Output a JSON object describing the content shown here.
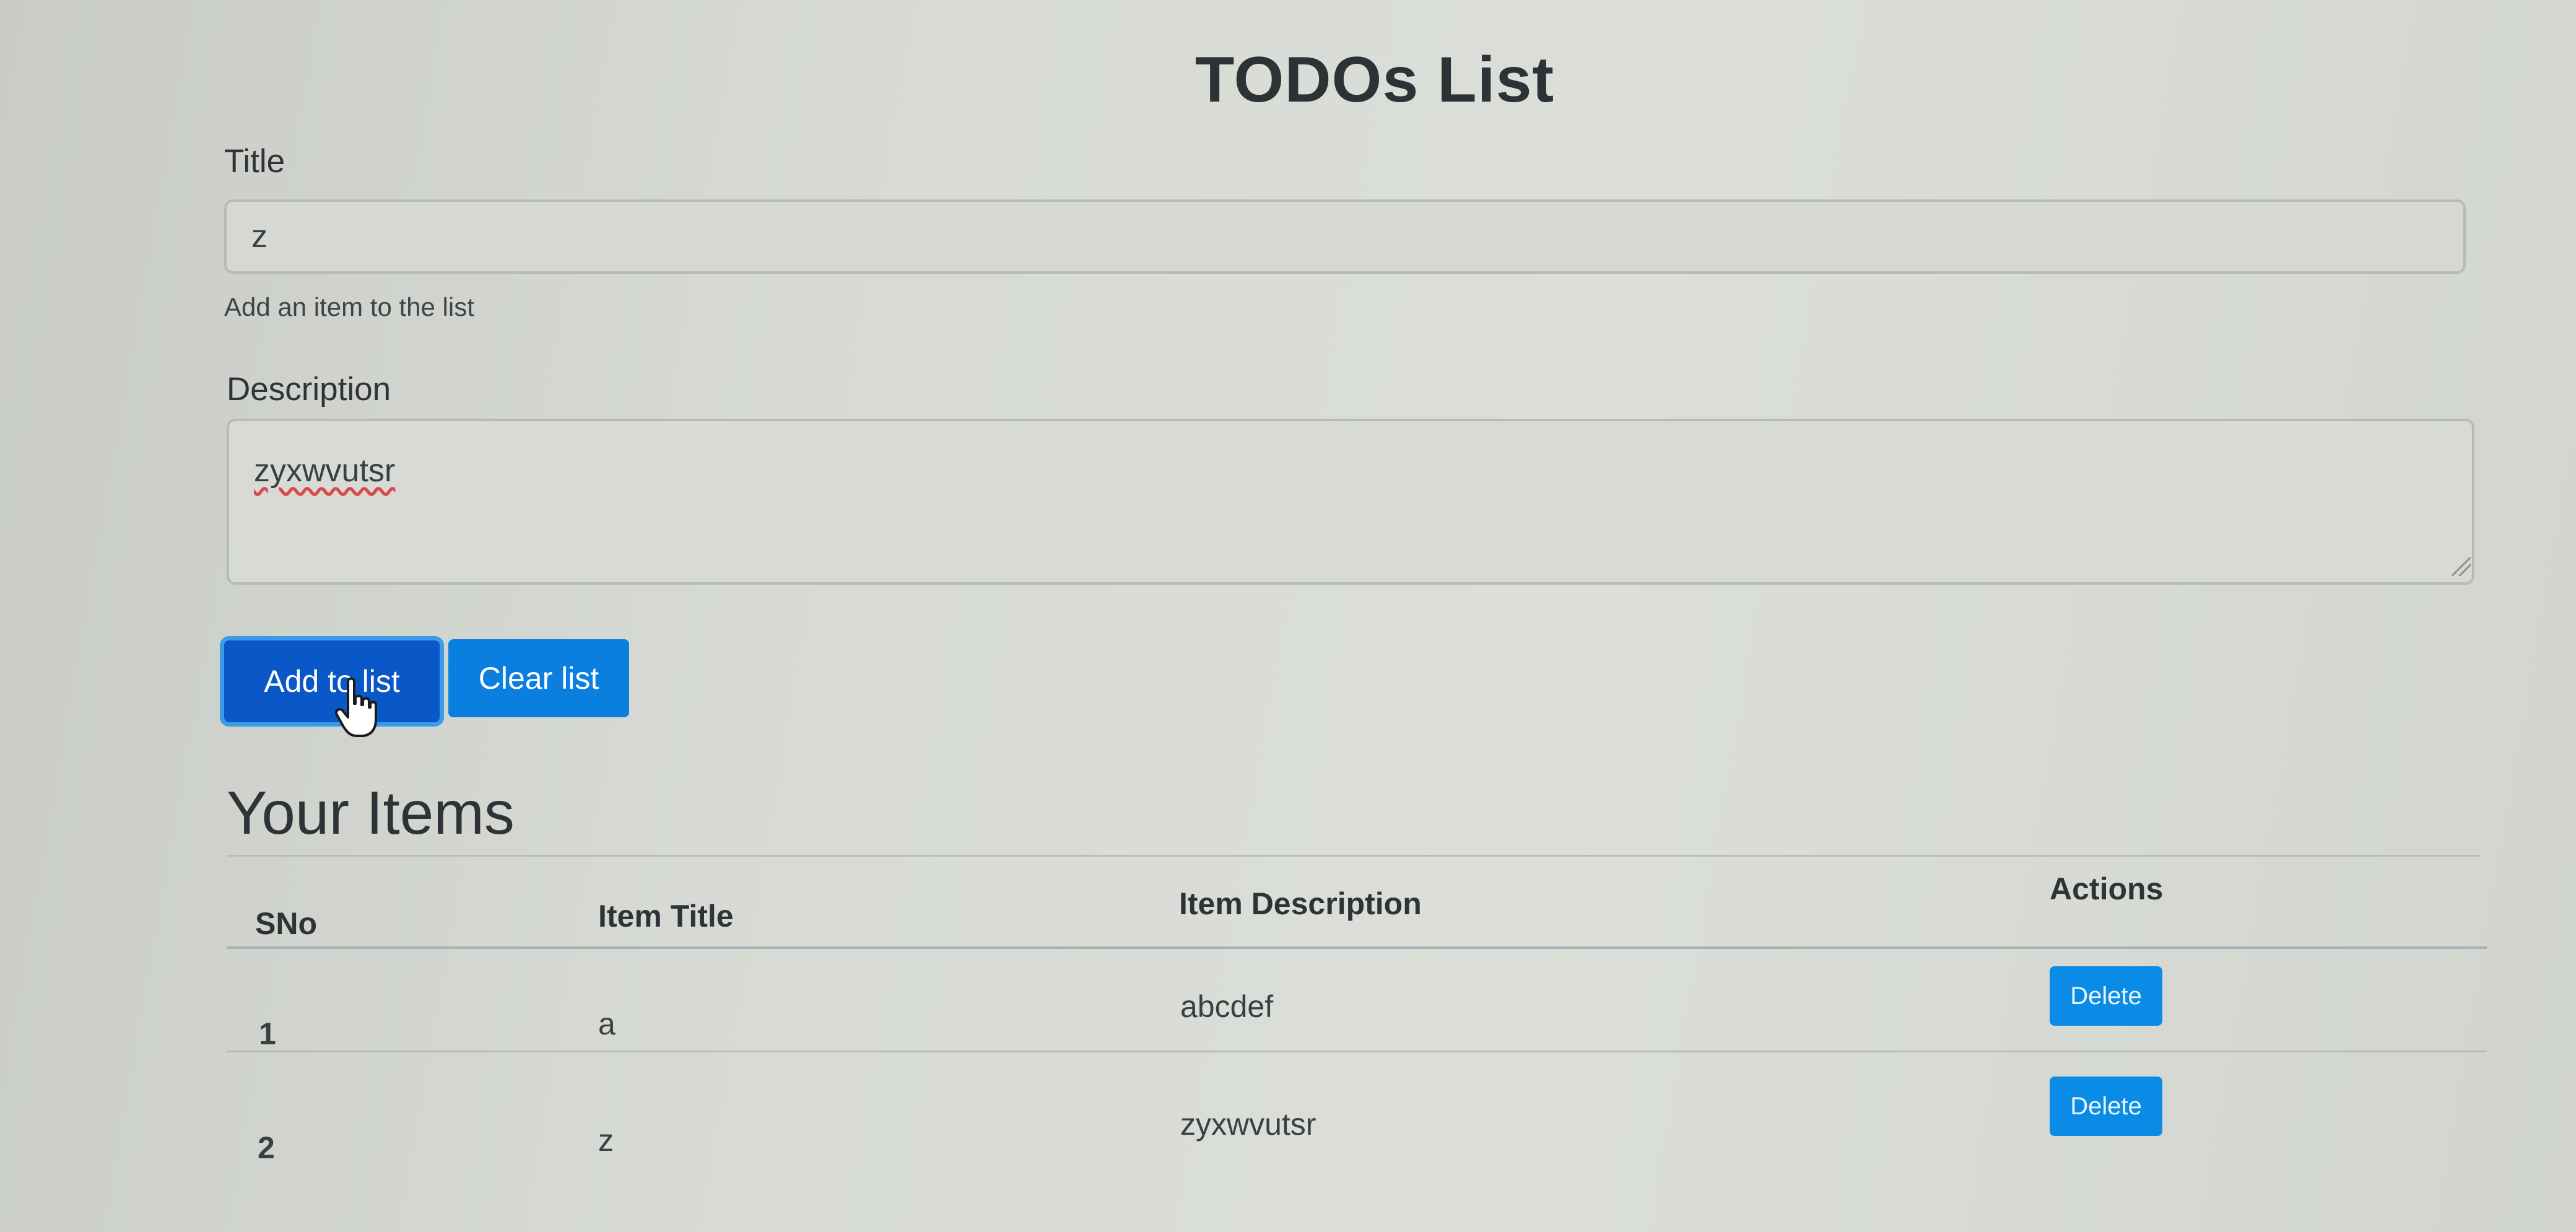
{
  "page": {
    "title": "TODOs List"
  },
  "form": {
    "title_label": "Title",
    "title_value": "z",
    "title_help": "Add an item to the list",
    "description_label": "Description",
    "description_value": "zyxwvutsr",
    "add_button_label": "Add to list",
    "clear_button_label": "Clear list"
  },
  "items_section": {
    "heading": "Your Items",
    "columns": [
      "SNo",
      "Item Title",
      "Item Description",
      "Actions"
    ],
    "rows": [
      {
        "sno": "1",
        "title": "a",
        "description": "abcdef",
        "action_label": "Delete"
      },
      {
        "sno": "2",
        "title": "z",
        "description": "zyxwvutsr",
        "action_label": "Delete"
      }
    ]
  },
  "colors": {
    "primary_button": "#0a57c8",
    "clear_button": "#0a7fe0",
    "delete_button": "#0a8be6"
  },
  "icons": {
    "cursor": "hand-pointer-icon"
  }
}
